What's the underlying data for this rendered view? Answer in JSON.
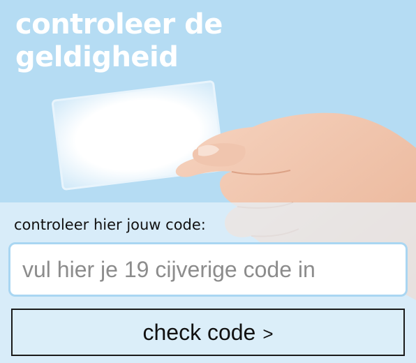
{
  "header": {
    "title_line1": "controleer de",
    "title_line2": "geldigheid"
  },
  "form": {
    "label": "controleer hier jouw code:",
    "code_input": {
      "placeholder": "vul hier je 19 cijverige code in",
      "value": ""
    },
    "submit": {
      "label": "check code",
      "icon": "chevron-right-icon",
      "icon_glyph": ">"
    }
  },
  "colors": {
    "background": "#b5dcf3",
    "panel": "#e6f3fb",
    "input_border": "#a9d6f2",
    "button_border": "#1a1a1a"
  }
}
